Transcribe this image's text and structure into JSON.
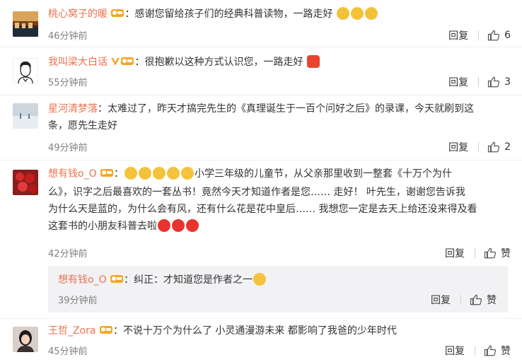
{
  "colors": {
    "username": "#eb7350",
    "text": "#333333",
    "meta": "#808080",
    "subreply_bg": "#f2f2f5"
  },
  "actions": {
    "reply_label": "回复",
    "like_label_default": "赞"
  },
  "comments": [
    {
      "username": "桃心窝子的暖",
      "text": "：感谢您留给孩子们的经典科普读物，一路走好",
      "trailing_emoji": [
        "pray-emoji",
        "pray-emoji",
        "pray-emoji"
      ],
      "time": "46分钟前",
      "likes": "6"
    },
    {
      "username": "我叫梁大白话",
      "text": "：很抱歉以这种方式认识您，一路走好",
      "trailing_emoji": [
        "candle-emoji"
      ],
      "time": "55分钟前",
      "likes": "3"
    },
    {
      "username": "星河清梦落",
      "text_line1": "：太难过了，昨天才搞完先生的《真理诞生于一百个问好之后》的录课，今天就刷到这",
      "text_line2": "条，愿先生走好",
      "time": "49分钟前",
      "likes": "2"
    },
    {
      "username": "想有钱o_O",
      "text_line1": "小学三年级的儿童节，从父亲那里收到一整套《十万个为什",
      "text_line2": "么》，识字之后最喜欢的一套丛书！竟然今天才知道作者是您…… 走好！ 叶先生，谢谢您告诉我",
      "text_line3": "为什么天是蓝的，为什么会有风，还有什么花是花中皇后…… 我想您一定是去天上给还没来得及看",
      "text_line4": "这套书的小朋友科普去啦",
      "time": "42分钟前",
      "likes": "赞",
      "sub_reply": {
        "username": "想有钱o_O",
        "text": "：纠正：才知道您是作者之一",
        "time": "39分钟前",
        "likes": "赞"
      }
    },
    {
      "username": "王哲_Zora",
      "text": "：不说十万个为什么了 小灵通漫游未来 都影响了我爸的少年时代",
      "time": "45分钟前",
      "likes": "赞"
    }
  ]
}
